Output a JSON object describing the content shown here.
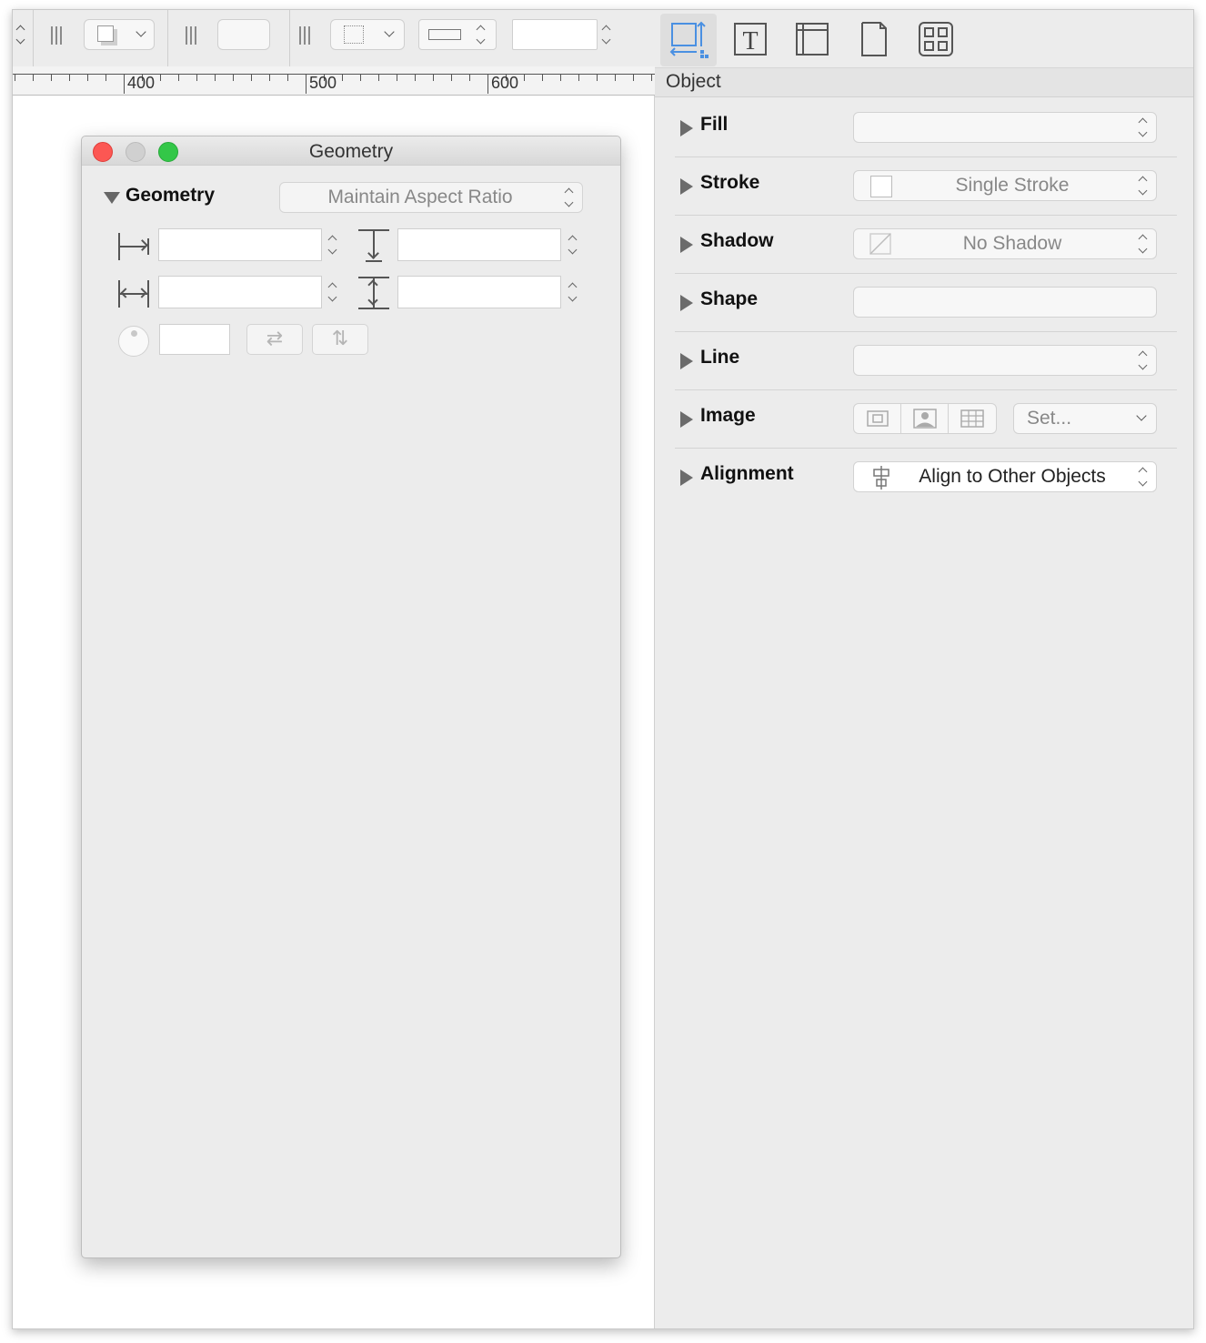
{
  "toolbar": {
    "number_field_value": ""
  },
  "ruler": {
    "labels": [
      "400",
      "500",
      "600"
    ]
  },
  "geometry_window": {
    "title": "Geometry",
    "section_label": "Geometry",
    "aspect_popup": "Maintain Aspect Ratio",
    "x_value": "",
    "y_value": "",
    "width_value": "",
    "height_value": "",
    "rotation_value": ""
  },
  "inspector": {
    "tabs": [
      "object-tab",
      "text-tab",
      "canvas-tab",
      "document-tab",
      "stencils-tab"
    ],
    "header": "Object",
    "rows": {
      "fill": {
        "label": "Fill",
        "value": ""
      },
      "stroke": {
        "label": "Stroke",
        "value": "Single Stroke"
      },
      "shadow": {
        "label": "Shadow",
        "value": "No Shadow"
      },
      "shape": {
        "label": "Shape",
        "value": ""
      },
      "line": {
        "label": "Line",
        "value": ""
      },
      "image": {
        "label": "Image",
        "set_label": "Set..."
      },
      "alignment": {
        "label": "Alignment",
        "value": "Align to Other Objects"
      }
    }
  },
  "colors": {
    "accent": "#4a90e2",
    "close": "#fc5753",
    "zoom": "#33c748"
  }
}
